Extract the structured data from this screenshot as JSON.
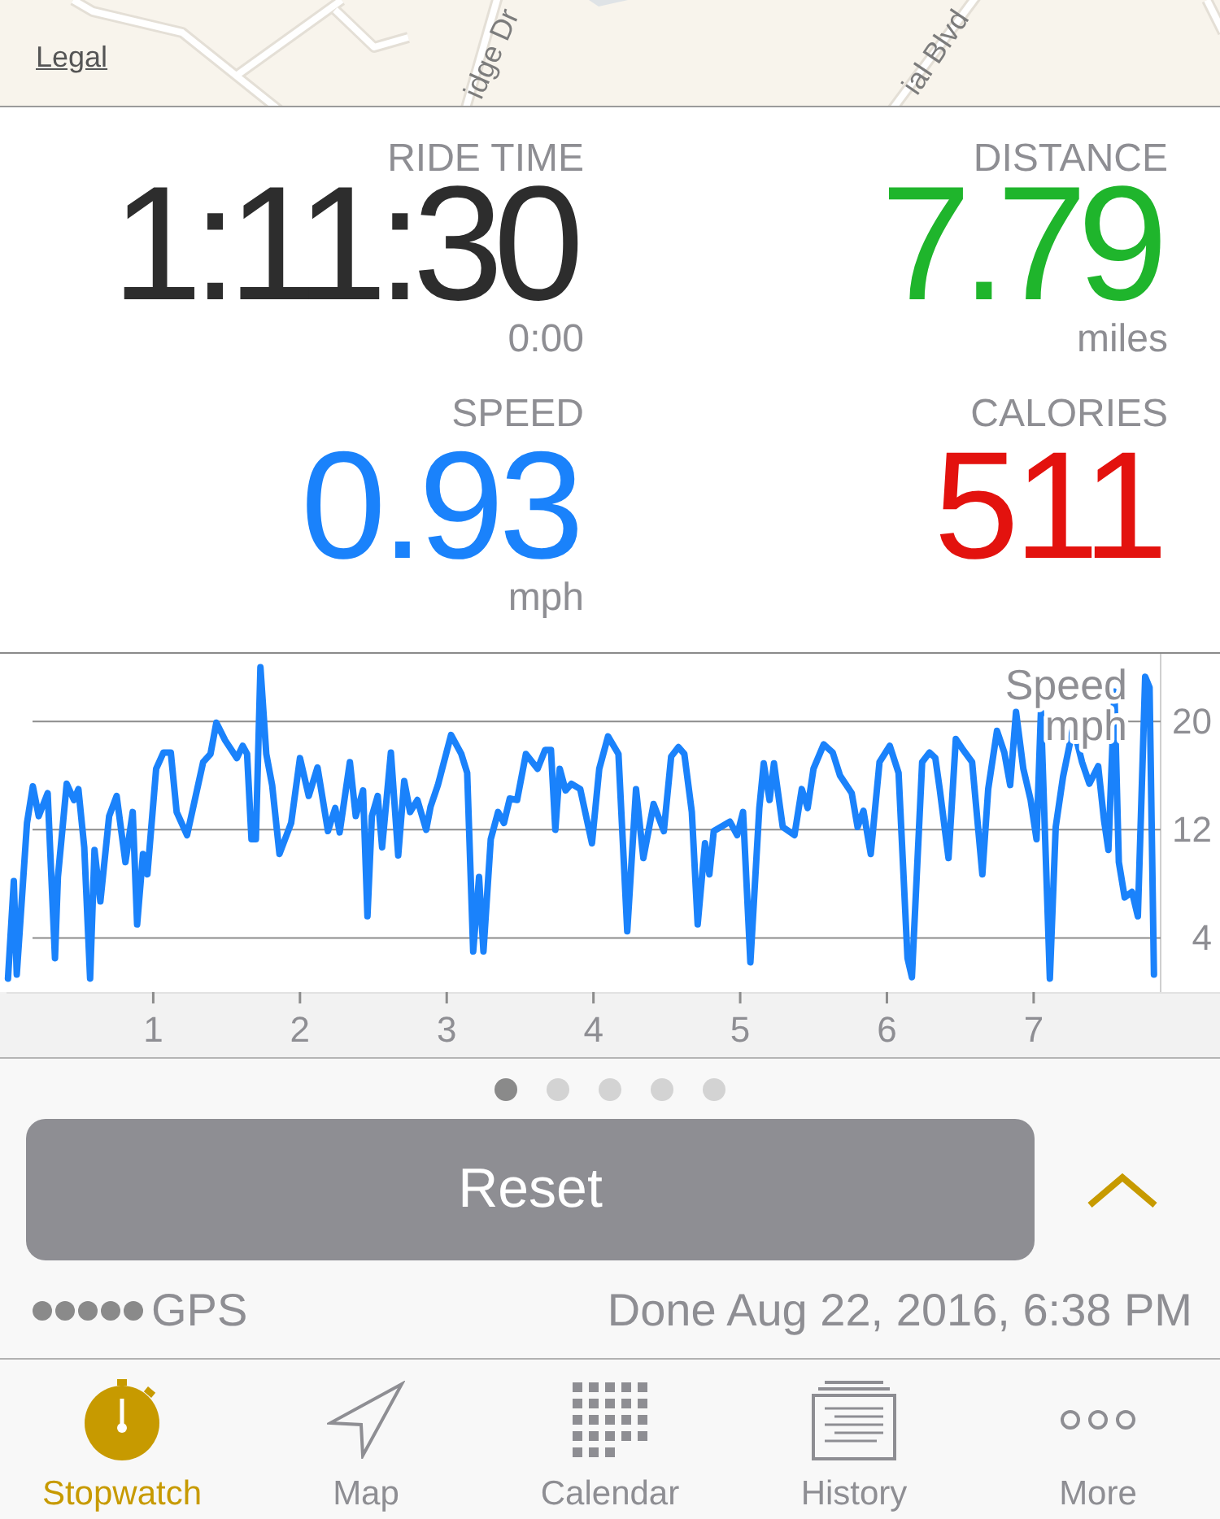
{
  "map": {
    "street_labels": [
      "idge Dr",
      "ial Blvd"
    ],
    "legal_link": "Legal"
  },
  "stats": [
    {
      "kind": "large",
      "label": "RIDE TIME",
      "value": "1:11:30",
      "note": "0:00",
      "color": "#2d2d2d"
    },
    {
      "kind": "large",
      "label": "DISTANCE",
      "value": "7.79",
      "note": "miles",
      "color": "#1fb52c"
    },
    {
      "kind": "medium",
      "label": "SPEED",
      "value": "0.93",
      "note": "mph",
      "color": "#1a82fb"
    },
    {
      "kind": "medium",
      "label": "CALORIES",
      "value": "511",
      "color": "#e3120e"
    }
  ],
  "chart": {
    "chart_data": {
      "type": "line",
      "title": "Speed",
      "ylabel": "mph",
      "grid": true,
      "xlim": [
        0,
        8.27
      ],
      "ylim": [
        0,
        25
      ],
      "xticks": [
        1,
        2,
        3,
        4,
        5,
        6,
        7
      ],
      "yticks": [
        4,
        12,
        20
      ],
      "x": [
        0.01,
        0.05,
        0.07,
        0.14,
        0.18,
        0.22,
        0.28,
        0.33,
        0.35,
        0.41,
        0.46,
        0.49,
        0.53,
        0.57,
        0.6,
        0.64,
        0.7,
        0.75,
        0.81,
        0.86,
        0.89,
        0.93,
        0.96,
        1.02,
        1.07,
        1.12,
        1.16,
        1.23,
        1.34,
        1.39,
        1.43,
        1.49,
        1.57,
        1.61,
        1.64,
        1.67,
        1.7,
        1.73,
        1.77,
        1.81,
        1.86,
        1.94,
        2.0,
        2.06,
        2.12,
        2.19,
        2.24,
        2.27,
        2.34,
        2.38,
        2.43,
        2.46,
        2.49,
        2.53,
        2.56,
        2.62,
        2.67,
        2.71,
        2.75,
        2.8,
        2.86,
        2.89,
        2.94,
        3.03,
        3.1,
        3.14,
        3.18,
        3.22,
        3.25,
        3.3,
        3.35,
        3.39,
        3.43,
        3.48,
        3.54,
        3.62,
        3.67,
        3.71,
        3.74,
        3.77,
        3.81,
        3.85,
        3.91,
        3.99,
        4.04,
        4.1,
        4.17,
        4.23,
        4.29,
        4.34,
        4.41,
        4.48,
        4.53,
        4.58,
        4.62,
        4.67,
        4.71,
        4.76,
        4.79,
        4.82,
        4.93,
        4.98,
        5.02,
        5.07,
        5.13,
        5.16,
        5.2,
        5.23,
        5.29,
        5.37,
        5.42,
        5.46,
        5.5,
        5.57,
        5.63,
        5.68,
        5.76,
        5.8,
        5.84,
        5.89,
        5.95,
        6.02,
        6.08,
        6.14,
        6.17,
        6.24,
        6.29,
        6.33,
        6.36,
        6.42,
        6.47,
        6.52,
        6.58,
        6.65,
        6.69,
        6.75,
        6.8,
        6.84,
        6.88,
        6.93,
        6.98,
        7.02,
        7.05,
        7.11,
        7.15,
        7.2,
        7.27,
        7.33,
        7.38,
        7.44,
        7.48,
        7.51,
        7.55,
        7.58,
        7.62,
        7.67,
        7.71,
        7.76,
        7.79,
        7.82
      ],
      "values": [
        1.0,
        8.2,
        1.3,
        12.5,
        15.2,
        13.0,
        14.7,
        2.5,
        8.5,
        15.4,
        14.2,
        15.0,
        10.7,
        1.0,
        10.5,
        6.7,
        13.0,
        14.5,
        9.6,
        13.3,
        5.0,
        10.2,
        8.7,
        16.5,
        17.7,
        17.7,
        13.3,
        11.6,
        17.0,
        17.6,
        19.9,
        18.6,
        17.3,
        18.2,
        17.6,
        11.3,
        11.3,
        24.0,
        17.6,
        15.3,
        10.2,
        12.5,
        17.3,
        14.5,
        16.6,
        11.9,
        13.6,
        11.8,
        17.0,
        13.0,
        14.9,
        5.6,
        13.0,
        14.5,
        10.7,
        17.7,
        10.1,
        15.6,
        13.3,
        14.2,
        12.0,
        13.7,
        15.3,
        19.0,
        17.6,
        16.2,
        3.0,
        8.5,
        3.0,
        11.3,
        13.3,
        12.5,
        14.3,
        14.2,
        17.6,
        16.5,
        17.9,
        17.9,
        12.0,
        16.5,
        14.9,
        15.4,
        15.0,
        11.0,
        16.5,
        18.9,
        17.6,
        4.5,
        15.0,
        9.9,
        13.9,
        11.9,
        17.4,
        18.1,
        17.6,
        13.3,
        5.0,
        11.0,
        8.7,
        11.9,
        12.6,
        11.6,
        13.3,
        2.2,
        13.6,
        16.9,
        14.2,
        16.9,
        12.2,
        11.6,
        15.0,
        13.6,
        16.5,
        18.3,
        17.7,
        16.0,
        14.7,
        12.2,
        13.4,
        10.2,
        17.0,
        18.2,
        16.2,
        2.5,
        1.1,
        17.0,
        17.7,
        17.3,
        15.0,
        9.9,
        18.7,
        17.9,
        17.0,
        8.7,
        15.0,
        19.3,
        17.7,
        15.3,
        20.7,
        16.5,
        14.2,
        11.3,
        20.7,
        1.0,
        12.2,
        15.9,
        19.6,
        17.0,
        15.4,
        16.7,
        12.7,
        10.5,
        22.2,
        9.6,
        7.0,
        7.4,
        5.6,
        23.3,
        22.5,
        1.3
      ]
    }
  },
  "pages": [
    {
      "selected": true
    },
    {
      "selected": false
    },
    {
      "selected": false
    },
    {
      "selected": false
    },
    {
      "selected": false
    }
  ],
  "reset_button": "Reset",
  "status_bar": {
    "gps": "GPS",
    "finished": "Done Aug 22, 2016, 6:38 PM"
  },
  "tabs": [
    {
      "label": "Stopwatch",
      "selected": true
    },
    {
      "label": "Map",
      "selected": false
    },
    {
      "label": "Calendar",
      "selected": false
    },
    {
      "label": "History",
      "selected": false
    },
    {
      "label": "More",
      "selected": false
    }
  ]
}
